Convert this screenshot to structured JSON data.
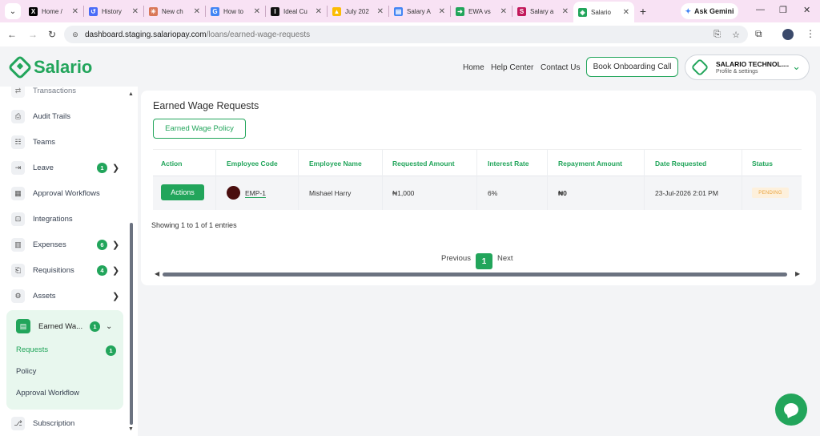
{
  "browser": {
    "tabs": [
      {
        "title": "Home /",
        "icon": "x-logo-icon",
        "color": "#000000"
      },
      {
        "title": "History",
        "icon": "history-icon",
        "color": "#4a6cf7"
      },
      {
        "title": "New ch",
        "icon": "claude-icon",
        "color": "#d97757"
      },
      {
        "title": "How to",
        "icon": "google-icon",
        "color": "#4285f4"
      },
      {
        "title": "Ideal Cu",
        "icon": "ideal-icon",
        "color": "#111111"
      },
      {
        "title": "July 202",
        "icon": "drive-icon",
        "color": "#fbbc04"
      },
      {
        "title": "Salary A",
        "icon": "docs-icon",
        "color": "#4285f4"
      },
      {
        "title": "EWA vs",
        "icon": "ewa-icon",
        "color": "#22a55b"
      },
      {
        "title": "Salary a",
        "icon": "salary-icon",
        "color": "#c2185b"
      },
      {
        "title": "Salario",
        "icon": "salario-icon",
        "color": "#22a55b"
      }
    ],
    "gemini_label": "Ask Gemini",
    "url_host": "dashboard.staging.salariopay.com",
    "url_path": "/loans/earned-wage-requests"
  },
  "header": {
    "logo_text": "Salario",
    "nav": [
      "Home",
      "Help Center",
      "Contact Us"
    ],
    "book_call": "Book Onboarding Call",
    "company_name": "SALARIO TECHNOL....",
    "company_sub": "Profile & settings"
  },
  "sidebar": {
    "cut_item": "Transactions",
    "items": [
      {
        "label": "Audit Trails",
        "icon": "audit-icon"
      },
      {
        "label": "Teams",
        "icon": "teams-icon"
      },
      {
        "label": "Leave",
        "icon": "leave-icon",
        "badge": "1"
      },
      {
        "label": "Approval Workflows",
        "icon": "workflow-icon"
      },
      {
        "label": "Integrations",
        "icon": "integrations-icon"
      },
      {
        "label": "Expenses",
        "icon": "expenses-icon",
        "badge": "6"
      },
      {
        "label": "Requisitions",
        "icon": "requisitions-icon",
        "badge": "4"
      },
      {
        "label": "Assets",
        "icon": "assets-icon"
      }
    ],
    "ewa": {
      "label": "Earned Wa...",
      "badge": "1",
      "subitems": [
        {
          "label": "Requests",
          "badge": "1"
        },
        {
          "label": "Policy"
        },
        {
          "label": "Approval Workflow"
        }
      ]
    },
    "subscription": "Subscription"
  },
  "main": {
    "title": "Earned Wage Requests",
    "policy_button": "Earned Wage Policy",
    "columns": [
      "Action",
      "Employee Code",
      "Employee Name",
      "Requested Amount",
      "Interest Rate",
      "Repayment Amount",
      "Date Requested",
      "Status"
    ],
    "rows": [
      {
        "action": "Actions",
        "employee_code": "EMP-1",
        "employee_name": "Mishael Harry",
        "requested_amount": "₦1,000",
        "interest_rate": "6%",
        "repayment_amount": "₦0",
        "date_requested": "23-Jul-2026 2:01 PM",
        "status": "PENDING"
      }
    ],
    "showing": "Showing 1 to 1 of 1 entries",
    "pagination": {
      "previous": "Previous",
      "current": "1",
      "next": "Next"
    }
  },
  "colors": {
    "brand": "#22a55b",
    "pending_bg": "#fdf0dc",
    "pending_text": "#e9a23b"
  }
}
